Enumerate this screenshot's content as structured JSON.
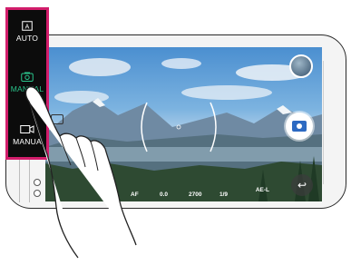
{
  "mode_menu": {
    "items": [
      {
        "label": "AUTO",
        "icon": "auto-icon",
        "active": false
      },
      {
        "label": "MANUAL",
        "icon": "camera-icon",
        "active": true
      },
      {
        "label": "MANUA",
        "icon": "video-icon",
        "active": false
      }
    ],
    "highlight_color": "#d21d6b",
    "active_color": "#2ac38b"
  },
  "settings_bar": [
    {
      "key": "",
      "value": "AF"
    },
    {
      "key": "",
      "value": "0.0"
    },
    {
      "key": "",
      "value": "2700"
    },
    {
      "key": "",
      "value": "1/9"
    }
  ],
  "ae_lock": "AE-L",
  "controls": {
    "shutter_icon": "camera-icon",
    "back_icon": "back-arrow-icon",
    "thumbnail_icon": "gallery-thumbnail"
  }
}
